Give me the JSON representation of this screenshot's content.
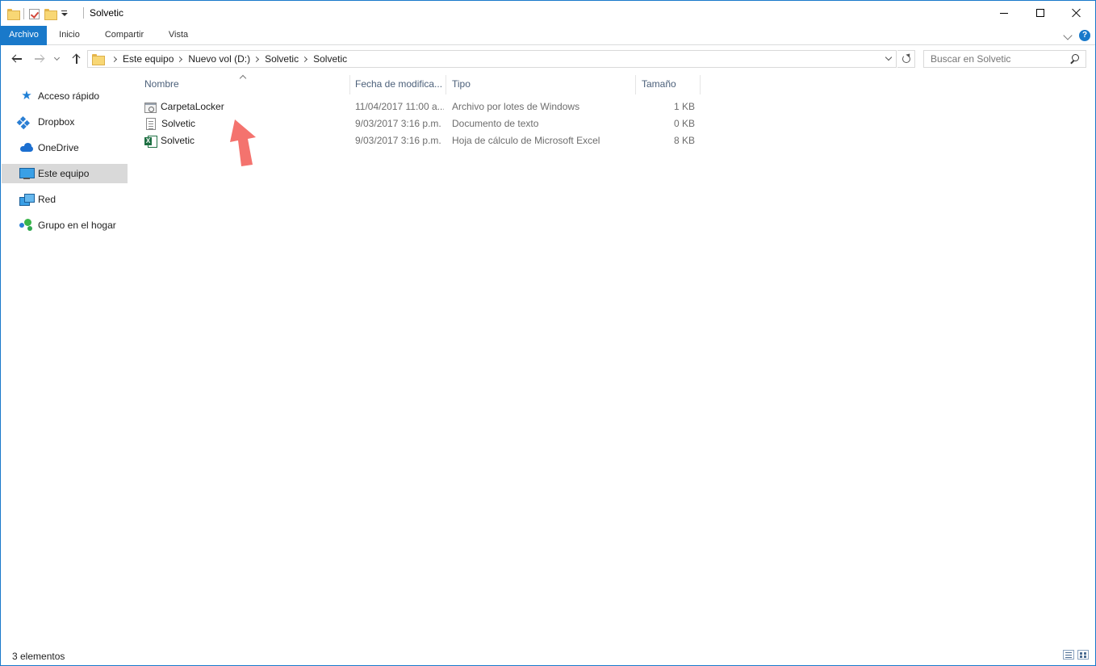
{
  "window": {
    "title": "Solvetic"
  },
  "ribbon": {
    "tabs": [
      {
        "label": "Archivo"
      },
      {
        "label": "Inicio"
      },
      {
        "label": "Compartir"
      },
      {
        "label": "Vista"
      }
    ],
    "help": "?"
  },
  "address": {
    "crumbs": [
      "Este equipo",
      "Nuevo vol (D:)",
      "Solvetic",
      "Solvetic"
    ]
  },
  "search": {
    "placeholder": "Buscar en Solvetic"
  },
  "sidebar": {
    "items": [
      {
        "label": "Acceso rápido",
        "icon": "quick-access-star-icon"
      },
      {
        "label": "Dropbox",
        "icon": "dropbox-icon"
      },
      {
        "label": "OneDrive",
        "icon": "onedrive-cloud-icon"
      },
      {
        "label": "Este equipo",
        "icon": "this-pc-icon",
        "selected": true
      },
      {
        "label": "Red",
        "icon": "network-icon"
      },
      {
        "label": "Grupo en el hogar",
        "icon": "homegroup-icon"
      }
    ]
  },
  "columns": {
    "name": "Nombre",
    "date": "Fecha de modifica...",
    "type": "Tipo",
    "size": "Tamaño"
  },
  "files": [
    {
      "name": "CarpetaLocker",
      "date": "11/04/2017 11:00 a...",
      "type": "Archivo por lotes de Windows",
      "size": "1 KB",
      "icon": "batch-file-icon"
    },
    {
      "name": "Solvetic",
      "date": "9/03/2017 3:16 p.m.",
      "type": "Documento de texto",
      "size": "0 KB",
      "icon": "text-file-icon"
    },
    {
      "name": "Solvetic",
      "date": "9/03/2017 3:16 p.m.",
      "type": "Hoja de cálculo de Microsoft Excel",
      "size": "8 KB",
      "icon": "excel-file-icon"
    }
  ],
  "status": {
    "count": "3 elementos"
  },
  "colors": {
    "accent": "#1979ca",
    "annotation_arrow": "#f4736e",
    "selected_nav": "#d9d9d9"
  }
}
